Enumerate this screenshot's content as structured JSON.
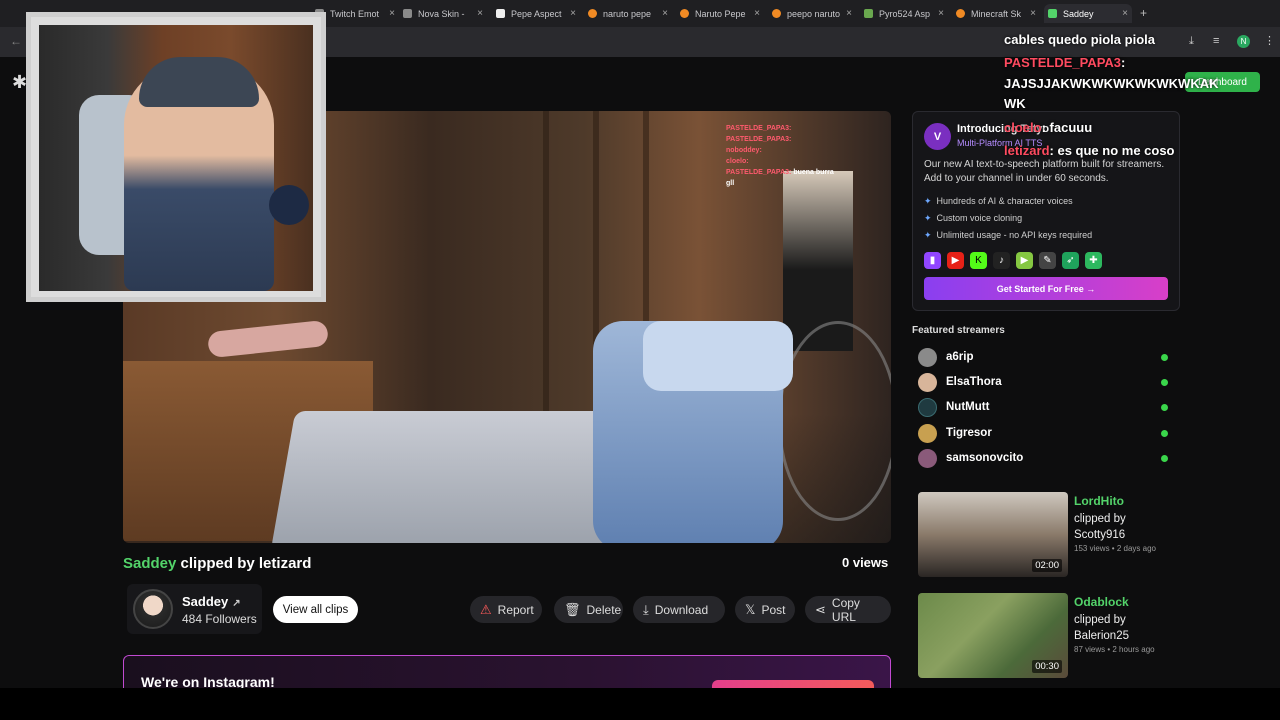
{
  "browser": {
    "tabs": [
      {
        "label": "Twitch Emot",
        "color": "#8a8a8a"
      },
      {
        "label": "Nova Skin -",
        "color": "#8a8a8a"
      },
      {
        "label": "Pepe Aspect",
        "color": "#eeeeee"
      },
      {
        "label": "naruto pepe",
        "color": "#f08a24"
      },
      {
        "label": "Naruto Pepe",
        "color": "#f08a24"
      },
      {
        "label": "peepo naruto",
        "color": "#f08a24"
      },
      {
        "label": "Pyro524 Asp",
        "color": "#6aa84f"
      },
      {
        "label": "Minecraft Sk",
        "color": "#f08a24"
      },
      {
        "label": "Saddey",
        "color": "#53d36a",
        "active": true
      }
    ],
    "new_tab": "+",
    "profile_initial": "N"
  },
  "video_chat": [
    {
      "user": "PASTELDE_PAPA3:",
      "msg": ""
    },
    {
      "user": "PASTELDE_PAPA3:",
      "msg": ""
    },
    {
      "user": "noboddey:",
      "msg": ""
    },
    {
      "user": "cloelo:",
      "msg": ""
    },
    {
      "user": "PASTELDE_PAPA3:",
      "msg": "buena burra"
    },
    {
      "user": "",
      "msg": "gll"
    }
  ],
  "overlay_chat": {
    "line1_msg": "cables quedo piola piola",
    "line2_user": "PASTELDE_PAPA3",
    "line2_msg": "JAJSJJAKWKWKWKWKWKWKAK",
    "line3_msg": "WK",
    "line4_user": "cloelo",
    "line4_msg": "facuuu",
    "line5_user": "letizard",
    "line5_msg": "es que no me coso"
  },
  "clip": {
    "channel": "Saddey",
    "clipped_by_text": "clipped by",
    "clipper": "letizard",
    "views": "0 views"
  },
  "channel": {
    "name": "Saddey",
    "followers": "484 Followers",
    "view_all": "View all clips"
  },
  "actions": {
    "report": "Report",
    "delete": "Delete",
    "download": "Download",
    "post": "Post",
    "copy_url": "Copy URL"
  },
  "instagram": {
    "title": "We're on Instagram!"
  },
  "sidebar": {
    "dashboard_button": "Dashboard",
    "ad": {
      "title": "Introducing Tetyo",
      "subtitle": "Multi-Platform AI TTS",
      "description": "Our new AI text-to-speech platform built for streamers. Add to your channel in under 60 seconds.",
      "bullets": [
        "Hundreds of AI & character voices",
        "Custom voice cloning",
        "Unlimited usage - no API keys required"
      ],
      "cta": "Get Started For Free →"
    },
    "featured_title": "Featured streamers",
    "featured": [
      {
        "name": "a6rip"
      },
      {
        "name": "ElsaThora"
      },
      {
        "name": "NutMutt"
      },
      {
        "name": "Tigresor"
      },
      {
        "name": "samsonovcito"
      }
    ],
    "related": [
      {
        "channel": "LordHito",
        "clipped_by": "clipped by Scotty916",
        "meta": "153 views • 2 days ago",
        "duration": "02:00"
      },
      {
        "channel": "Odablock",
        "clipped_by": "clipped by Balerion25",
        "meta": "87 views • 2 hours ago",
        "duration": "00:30"
      }
    ]
  }
}
